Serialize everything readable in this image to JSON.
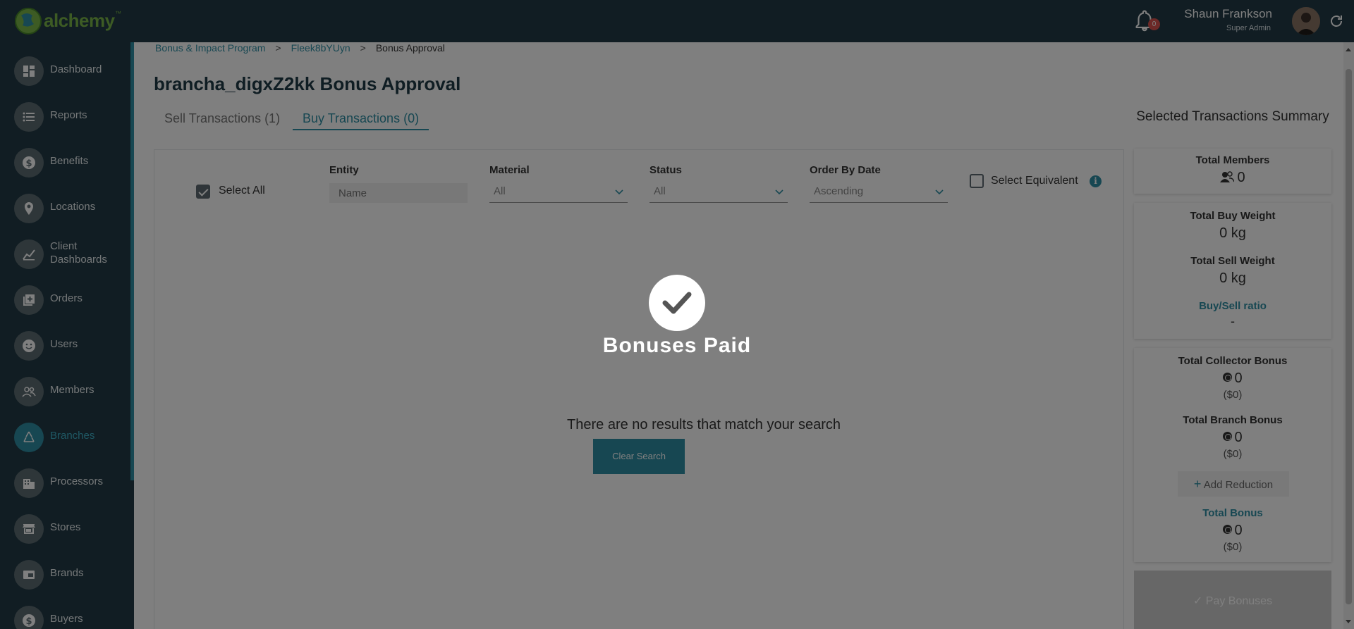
{
  "app": {
    "logo_text": "alchemy",
    "logo_tm": "™",
    "notification_count": "0",
    "user_name": "Shaun Frankson",
    "user_role": "Super Admin"
  },
  "sidebar": {
    "items": [
      {
        "label": "Dashboard",
        "icon": "dashboard-icon"
      },
      {
        "label": "Reports",
        "icon": "list-icon"
      },
      {
        "label": "Benefits",
        "icon": "dollar-icon"
      },
      {
        "label": "Locations",
        "icon": "map-pin-icon"
      },
      {
        "label": "Client Dashboards",
        "icon": "chart-icon"
      },
      {
        "label": "Orders",
        "icon": "add-box-icon"
      },
      {
        "label": "Users",
        "icon": "face-icon"
      },
      {
        "label": "Members",
        "icon": "group-icon"
      },
      {
        "label": "Branches",
        "icon": "recycle-icon",
        "active": true
      },
      {
        "label": "Processors",
        "icon": "building-icon"
      },
      {
        "label": "Stores",
        "icon": "store-icon"
      },
      {
        "label": "Brands",
        "icon": "card-icon"
      },
      {
        "label": "Buyers",
        "icon": "dollar-icon"
      }
    ]
  },
  "breadcrumb": {
    "items": [
      "Bonus & Impact Program",
      "Fleek8bYUyn",
      "Bonus Approval"
    ],
    "separator": ">"
  },
  "page": {
    "title": "brancha_digxZ2kk Bonus Approval",
    "tabs": [
      "Sell Transactions (1)",
      "Buy Transactions (0)"
    ],
    "active_tab": "Buy Transactions (0)"
  },
  "filters": {
    "select_all_label": "Select All",
    "select_all_checked": true,
    "entity_label": "Entity",
    "entity_placeholder": "Name",
    "material_label": "Material",
    "material_value": "All",
    "status_label": "Status",
    "status_value": "All",
    "order_label": "Order By Date",
    "order_value": "Ascending",
    "select_equivalent_label": "Select Equivalent",
    "select_equivalent_checked": false
  },
  "results": {
    "empty_message": "There are no results that match your search",
    "clear_button": "Clear Search"
  },
  "summary": {
    "title": "Selected Transactions Summary",
    "total_members_label": "Total Members",
    "total_members_value": "0",
    "total_buy_weight_label": "Total Buy Weight",
    "total_buy_weight_value": "0 kg",
    "total_sell_weight_label": "Total Sell Weight",
    "total_sell_weight_value": "0 kg",
    "buy_sell_ratio_label": "Buy/Sell ratio",
    "buy_sell_ratio_value": "-",
    "collector_bonus_label": "Total Collector Bonus",
    "collector_bonus_value": "0",
    "collector_bonus_usd": "($0)",
    "branch_bonus_label": "Total Branch Bonus",
    "branch_bonus_value": "0",
    "branch_bonus_usd": "($0)",
    "add_reduction_label": "Add Reduction",
    "total_bonus_label": "Total Bonus",
    "total_bonus_value": "0",
    "total_bonus_usd": "($0)",
    "pay_button": "Pay Bonuses"
  },
  "modal": {
    "message": "Bonuses Paid"
  },
  "colors": {
    "brand_dark": "#223b46",
    "accent": "#2f8fa4",
    "logo_green": "#7ab648"
  }
}
